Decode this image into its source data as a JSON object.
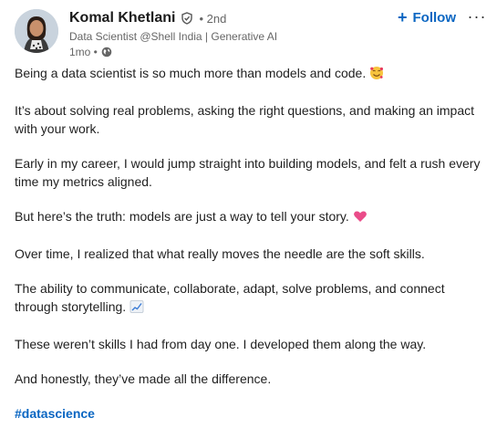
{
  "author": {
    "name": "Komal Khetlani",
    "degree": "• 2nd",
    "headline": "Data Scientist @Shell India | Generative AI",
    "time": "1mo •"
  },
  "actions": {
    "follow_label": "Follow",
    "more_label": "···"
  },
  "post": {
    "paragraphs": [
      "Being a data scientist is so much more than models and code.",
      "It’s about solving real problems, asking the right questions, and making an impact with your work.",
      "Early in my career, I would jump straight into building models, and felt a rush every time my metrics aligned.",
      "But here’s the truth: models are just a way to tell your story.",
      "Over time, I realized that what really moves the needle are the soft skills.",
      "The ability to communicate, collaborate, adapt, solve problems, and connect through storytelling.",
      "These weren’t skills I had from day one. I developed them along the way.",
      "And honestly, they’ve made all the difference."
    ],
    "hashtag": "#datascience"
  },
  "icons": {
    "badge": "verified-shield-icon",
    "globe": "globe-icon",
    "emoji_1": "smiling-face-with-hearts-emoji",
    "emoji_2": "pink-heart-emoji",
    "emoji_3": "chart-increasing-emoji"
  },
  "colors": {
    "accent": "#0a66c2",
    "secondary_text": "#666666"
  }
}
